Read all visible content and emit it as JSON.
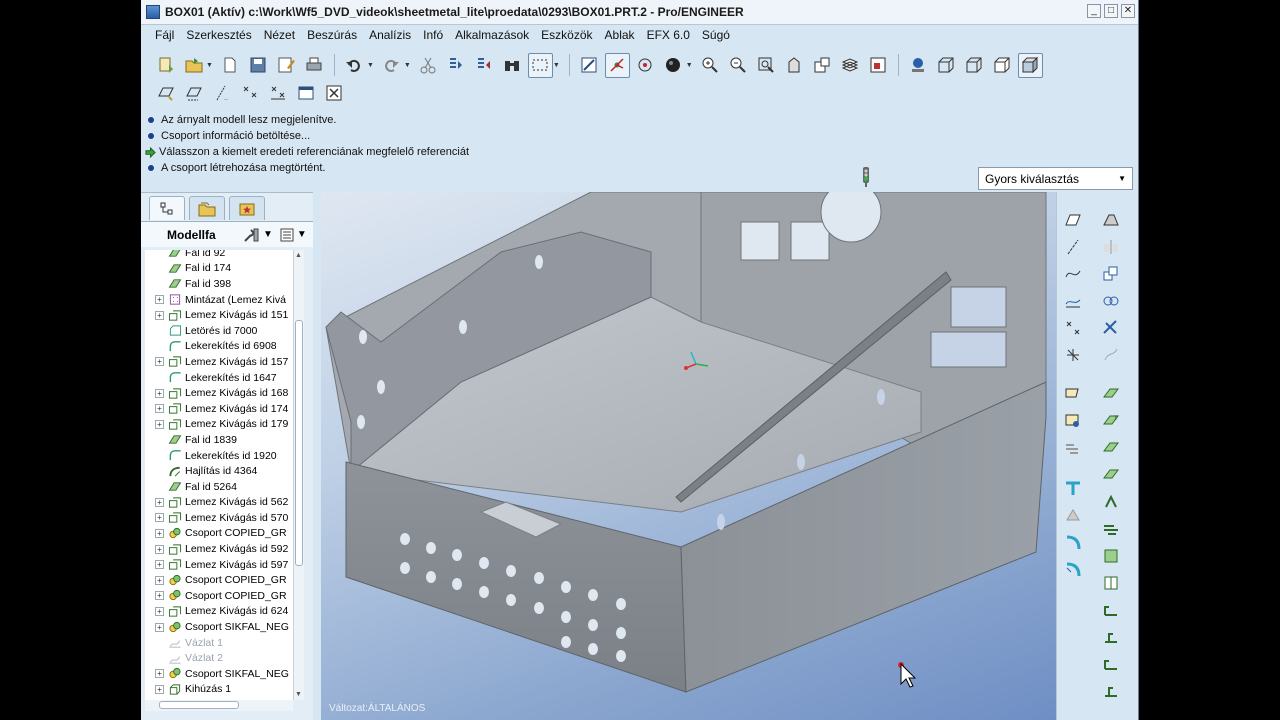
{
  "window": {
    "title": "BOX01 (Aktív) c:\\Work\\Wf5_DVD_videok\\sheetmetal_lite\\proedata\\0293\\BOX01.PRT.2 - Pro/ENGINEER",
    "minimize": "_",
    "maximize": "□",
    "close": "✕"
  },
  "menu": [
    "Fájl",
    "Szerkesztés",
    "Nézet",
    "Beszúrás",
    "Analízis",
    "Infó",
    "Alkalmazások",
    "Eszközök",
    "Ablak",
    "EFX 6.0",
    "Súgó"
  ],
  "messages": [
    {
      "type": "info",
      "text": "Az árnyalt modell lesz megjelenítve."
    },
    {
      "type": "info",
      "text": "Csoport információ betöltése..."
    },
    {
      "type": "prompt",
      "text": "Válasszon a kiemelt eredeti referenciának megfelelő referenciát"
    },
    {
      "type": "info",
      "text": "A csoport létrehozása megtörtént."
    }
  ],
  "quick_select": {
    "value": "Gyors kiválasztás",
    "caret": "▼"
  },
  "tree": {
    "title": "Modellfa",
    "rows": [
      {
        "label": "Fal id 92",
        "icon": "wall-icon",
        "expander": "",
        "dim": false
      },
      {
        "label": "Fal id 174",
        "icon": "wall-icon",
        "expander": "",
        "dim": false
      },
      {
        "label": "Fal id 398",
        "icon": "wall-icon",
        "expander": "",
        "dim": false
      },
      {
        "label": "Mintázat (Lemez Kivá",
        "icon": "pattern-icon",
        "expander": "+",
        "dim": false
      },
      {
        "label": "Lemez Kivágás id 151",
        "icon": "cut-icon",
        "expander": "+",
        "dim": false
      },
      {
        "label": "Letörés id 7000",
        "icon": "chamfer-icon",
        "expander": "",
        "dim": false
      },
      {
        "label": "Lekerekítés id 6908",
        "icon": "round-icon",
        "expander": "",
        "dim": false
      },
      {
        "label": "Lemez Kivágás id 157",
        "icon": "cut-icon",
        "expander": "+",
        "dim": false
      },
      {
        "label": "Lekerekítés id 1647",
        "icon": "round-icon",
        "expander": "",
        "dim": false
      },
      {
        "label": "Lemez Kivágás id 168",
        "icon": "cut-icon",
        "expander": "+",
        "dim": false
      },
      {
        "label": "Lemez Kivágás id 174",
        "icon": "cut-icon",
        "expander": "+",
        "dim": false
      },
      {
        "label": "Lemez Kivágás id 179",
        "icon": "cut-icon",
        "expander": "+",
        "dim": false
      },
      {
        "label": "Fal id 1839",
        "icon": "wall-icon",
        "expander": "",
        "dim": false
      },
      {
        "label": "Lekerekítés id 1920",
        "icon": "round-icon",
        "expander": "",
        "dim": false
      },
      {
        "label": "Hajlítás id 4364",
        "icon": "bend-icon",
        "expander": "",
        "dim": false
      },
      {
        "label": "Fal id 5264",
        "icon": "wall-icon",
        "expander": "",
        "dim": false
      },
      {
        "label": "Lemez Kivágás id 562",
        "icon": "cut-icon",
        "expander": "+",
        "dim": false
      },
      {
        "label": "Lemez Kivágás id 570",
        "icon": "cut-icon",
        "expander": "+",
        "dim": false
      },
      {
        "label": "Csoport COPIED_GR",
        "icon": "group-icon",
        "expander": "+",
        "dim": false
      },
      {
        "label": "Lemez Kivágás id 592",
        "icon": "cut-icon",
        "expander": "+",
        "dim": false
      },
      {
        "label": "Lemez Kivágás id 597",
        "icon": "cut-icon",
        "expander": "+",
        "dim": false
      },
      {
        "label": "Csoport COPIED_GR",
        "icon": "group-icon",
        "expander": "+",
        "dim": false
      },
      {
        "label": "Csoport COPIED_GR",
        "icon": "group-icon",
        "expander": "+",
        "dim": false
      },
      {
        "label": "Lemez Kivágás id 624",
        "icon": "cut-icon",
        "expander": "+",
        "dim": false
      },
      {
        "label": "Csoport SIKFAL_NEG",
        "icon": "group-icon",
        "expander": "+",
        "dim": false
      },
      {
        "label": "Vázlat 1",
        "icon": "sketch-icon",
        "expander": "",
        "dim": true
      },
      {
        "label": "Vázlat 2",
        "icon": "sketch-icon",
        "expander": "",
        "dim": true
      },
      {
        "label": "Csoport SIKFAL_NEG",
        "icon": "group-icon",
        "expander": "+",
        "dim": false
      },
      {
        "label": "Kihúzás 1",
        "icon": "extrude-icon",
        "expander": "+",
        "dim": false
      }
    ]
  },
  "viewport": {
    "variant_label": "Változat:ÁLTALÁNOS"
  },
  "colors": {
    "accent": "#2a5fa8",
    "background": "#d6e6f2",
    "model": "#a9adb3"
  }
}
